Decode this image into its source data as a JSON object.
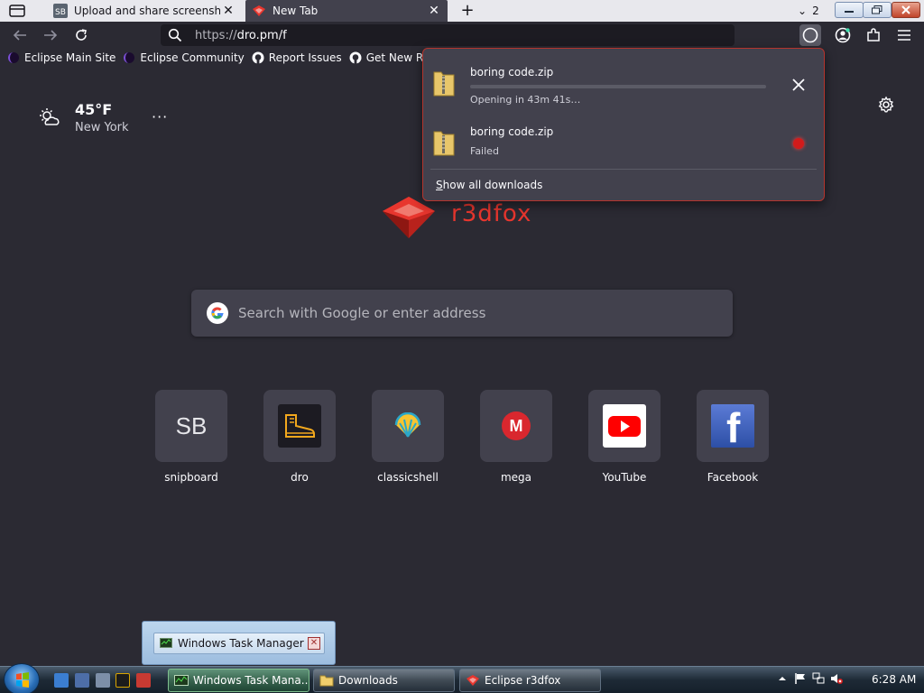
{
  "tabs": [
    {
      "favicon": "snipboard-icon",
      "title": "Upload and share screenshots a",
      "active": false
    },
    {
      "favicon": "r3dfox-icon",
      "title": "New Tab",
      "active": true
    }
  ],
  "tablist_count": "2",
  "urlbar": {
    "scheme": "https://",
    "rest": "dro.pm/f"
  },
  "bookmarks": [
    {
      "icon": "eclipse-icon",
      "label": "Eclipse Main Site"
    },
    {
      "icon": "eclipse-icon",
      "label": "Eclipse Community"
    },
    {
      "icon": "github-icon",
      "label": "Report Issues"
    },
    {
      "icon": "github-icon",
      "label": "Get New Releases"
    }
  ],
  "weather": {
    "temp": "45°F",
    "city": "New York",
    "menu": "···"
  },
  "logo": {
    "wordmark": "r3dfox"
  },
  "search": {
    "placeholder": "Search with Google or enter address"
  },
  "tiles": [
    {
      "label": "snipboard",
      "icon": "sb-icon",
      "text": "SB"
    },
    {
      "label": "dro",
      "icon": "boot-icon"
    },
    {
      "label": "classicshell",
      "icon": "shell-icon"
    },
    {
      "label": "mega",
      "icon": "mega-icon",
      "text": "M"
    },
    {
      "label": "YouTube",
      "icon": "youtube-icon"
    },
    {
      "label": "Facebook",
      "icon": "facebook-icon",
      "text": "f"
    }
  ],
  "downloads": {
    "items": [
      {
        "name": "boring code.zip",
        "status": "Opening in 43m 41s…",
        "progress": 0.0
      },
      {
        "name": "boring code.zip",
        "status": "Failed"
      }
    ],
    "show_all_prefix": "S",
    "show_all_rest": "how all downloads"
  },
  "taskbar": {
    "buttons": [
      {
        "label": "Windows Task Mana...",
        "icon": "task-manager-icon",
        "active": true
      },
      {
        "label": "Downloads",
        "icon": "folder-icon",
        "active": false
      },
      {
        "label": "Eclipse r3dfox",
        "icon": "r3dfox-icon",
        "active": false
      }
    ],
    "clock": "6:28 AM"
  },
  "thumbnail": {
    "label": "Windows Task Manager"
  },
  "colors": {
    "accent": "#e8362e",
    "bg": "#2b2a33",
    "surface": "#42414d"
  }
}
